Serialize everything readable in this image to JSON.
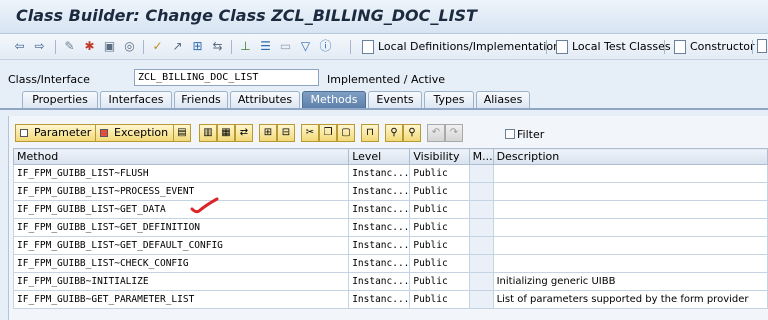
{
  "window": {
    "title": "Class Builder: Change Class ZCL_BILLING_DOC_LIST"
  },
  "toolbar": {
    "icons": [
      "back-arrow-icon",
      "forward-arrow-icon",
      "display-change-icon",
      "activate-icon",
      "where-used-icon",
      "object-list-icon",
      "check-icon",
      "rename-icon",
      "navigate-icon",
      "display-object-icon",
      "hierarchy-icon",
      "tree-icon",
      "frame-icon",
      "filter-icon",
      "info-icon"
    ],
    "local_definitions_label": "Local Definitions/Implementations",
    "local_test_classes_label": "Local Test Classes",
    "constructor_label": "Constructor"
  },
  "header": {
    "class_interface_label": "Class/Interface",
    "class_interface_value": "ZCL_BILLING_DOC_LIST",
    "status": "Implemented / Active"
  },
  "tabs": [
    {
      "label": "Properties",
      "active": false
    },
    {
      "label": "Interfaces",
      "active": false
    },
    {
      "label": "Friends",
      "active": false
    },
    {
      "label": "Attributes",
      "active": false
    },
    {
      "label": "Methods",
      "active": true
    },
    {
      "label": "Events",
      "active": false
    },
    {
      "label": "Types",
      "active": false
    },
    {
      "label": "Aliases",
      "active": false
    }
  ],
  "methods_toolbar": {
    "parameter_label": "Parameter",
    "exception_label": "Exception",
    "filter_label": "Filter"
  },
  "table": {
    "columns": [
      "Method",
      "Level",
      "Visibility",
      "M...",
      "Description"
    ],
    "rows": [
      {
        "method": "IF_FPM_GUIBB_LIST~FLUSH",
        "level": "Instanc...",
        "visibility": "Public",
        "m": "",
        "description": ""
      },
      {
        "method": "IF_FPM_GUIBB_LIST~PROCESS_EVENT",
        "level": "Instanc...",
        "visibility": "Public",
        "m": "",
        "description": ""
      },
      {
        "method": "IF_FPM_GUIBB_LIST~GET_DATA",
        "level": "Instanc...",
        "visibility": "Public",
        "m": "",
        "description": ""
      },
      {
        "method": "IF_FPM_GUIBB_LIST~GET_DEFINITION",
        "level": "Instanc...",
        "visibility": "Public",
        "m": "",
        "description": ""
      },
      {
        "method": "IF_FPM_GUIBB_LIST~GET_DEFAULT_CONFIG",
        "level": "Instanc...",
        "visibility": "Public",
        "m": "",
        "description": ""
      },
      {
        "method": "IF_FPM_GUIBB_LIST~CHECK_CONFIG",
        "level": "Instanc...",
        "visibility": "Public",
        "m": "",
        "description": ""
      },
      {
        "method": "IF_FPM_GUIBB~INITIALIZE",
        "level": "Instanc...",
        "visibility": "Public",
        "m": "",
        "description": "Initializing generic UIBB"
      },
      {
        "method": "IF_FPM_GUIBB~GET_PARAMETER_LIST",
        "level": "Instanc...",
        "visibility": "Public",
        "m": "",
        "description": "List of parameters supported by the form provider"
      }
    ]
  },
  "colors": {
    "tab_active": "#5d80ab",
    "annotation_check": "#d9262a",
    "button_yellow": "#f2d978"
  }
}
